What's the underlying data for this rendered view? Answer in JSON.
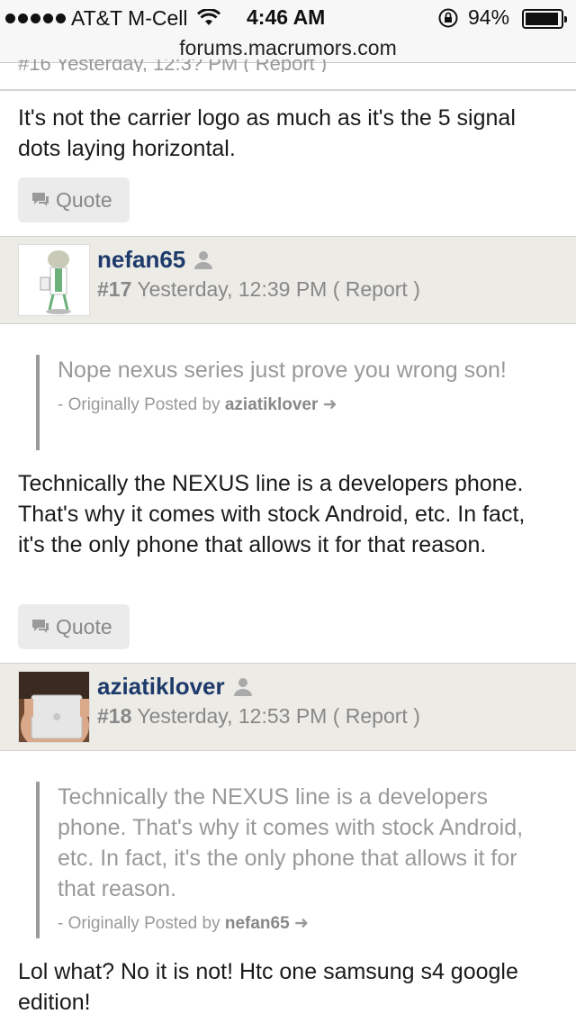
{
  "status_bar": {
    "carrier": "AT&T M-Cell",
    "time": "4:46 AM",
    "battery": "94%",
    "icons": [
      "signal-dots-icon",
      "wifi-icon",
      "rotation-lock-icon",
      "battery-icon"
    ]
  },
  "url_bar": {
    "domain": "forums.macrumors.com"
  },
  "prev_post": {
    "header_cut": "#16 Yesterday, 12:3? PM ( Report )",
    "body": "It's not the carrier logo as much as it's the 5 signal dots laying horizontal.",
    "quote_label": "Quote"
  },
  "posts": [
    {
      "username": "nefan65",
      "number": "#17",
      "date": "Yesterday, 12:39 PM",
      "report_label": "( Report )",
      "quote_text": "Nope nexus series just prove you wrong son!",
      "quote_prefix": "- Originally Posted by",
      "quote_author": "aziatiklover",
      "body": "Technically the NEXUS line is a developers phone. That's why it comes with stock Android, etc. In fact, it's the only phone that allows it for that reason.",
      "quote_label": "Quote"
    },
    {
      "username": "aziatiklover",
      "number": "#18",
      "date": "Yesterday, 12:53 PM",
      "report_label": "( Report )",
      "quote_text": "Technically the NEXUS line is a developers phone. That's why it comes with stock Android, etc. In fact, it's the only phone that allows it for that reason.",
      "quote_prefix": "- Originally Posted by",
      "quote_author": "nefan65",
      "body": "Lol what? No it is not! Htc one samsung s4 google edition!"
    }
  ]
}
